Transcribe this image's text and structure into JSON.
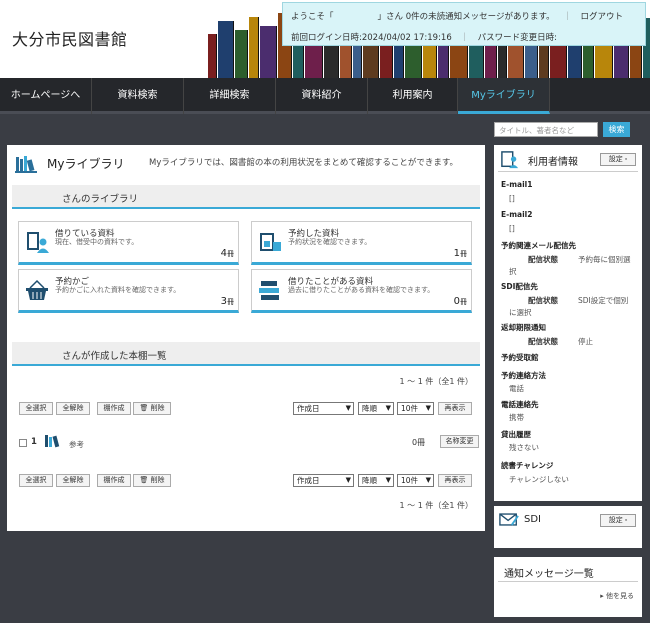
{
  "header": {
    "logo": "大分市民図書館",
    "welcome_prefix": "ようこそ「",
    "welcome_suffix": "」さん",
    "unread_notice": "0件の未読通知メッセージがあります。",
    "logout": "ログアウト",
    "last_login": "前回ログイン日時:2024/04/02 17:19:16",
    "password_changed": "パスワード変更日時:"
  },
  "nav": {
    "tabs": [
      "ホームページへ",
      "資料検索",
      "詳細検索",
      "資料紹介",
      "利用案内",
      "Myライブラリ"
    ],
    "active": 5
  },
  "search": {
    "placeholder": "タイトル、著者名など",
    "button": "検索"
  },
  "main": {
    "title": "Myライブラリ",
    "description": "Myライブラリでは、図書館の本の利用状況をまとめて確認することができます。",
    "library_heading": "さんのライブラリ",
    "cards": [
      {
        "title": "借りている資料",
        "desc": "現在、借受中の資料です。",
        "count": "4",
        "unit": "冊"
      },
      {
        "title": "予約した資料",
        "desc": "予約状況を確認できます。",
        "count": "1",
        "unit": "冊"
      },
      {
        "title": "予約かご",
        "desc": "予約かごに入れた資料を確認できます。",
        "count": "3",
        "unit": "冊"
      },
      {
        "title": "借りたことがある資料",
        "desc": "過去に借りたことがある資料を確認できます。",
        "count": "0",
        "unit": "冊"
      }
    ],
    "shelf_heading": "さんが作成した本棚一覧",
    "pager": "1 ～ 1 件（全1 件）",
    "toolbar": {
      "select_all": "全選択",
      "clear_all": "全解除",
      "create_shelf": "棚作成",
      "delete": "削除",
      "sort": "作成日",
      "order": "降順",
      "per_page": "10件",
      "redisplay": "再表示"
    },
    "shelf_row": {
      "index": "1",
      "name": "参考",
      "count": "0冊",
      "rename": "名称変更"
    }
  },
  "sidebar": {
    "user_info": {
      "title": "利用者情報",
      "settings": "設定",
      "email1_label": "E-mail1",
      "email1_value": "[]",
      "email2_label": "E-mail2",
      "email2_value": "[]",
      "reserve_mail_label": "予約関連メール配信先",
      "reserve_mail_status": "配信状態",
      "reserve_mail_value_a": "予約毎に個別選",
      "reserve_mail_value_b": "択",
      "sdi_label": "SDI配信先",
      "sdi_status": "配信状態",
      "sdi_value_a": "SDI設定で個別",
      "sdi_value_b": "に選択",
      "return_label": "返却期限通知",
      "return_status": "配信状態",
      "return_value": "停止",
      "pickup_label": "予約受取館",
      "contact_label": "予約連絡方法",
      "contact_value": "電話",
      "phone_label": "電話連絡先",
      "phone_value": "携帯",
      "history_label": "貸出履歴",
      "history_value": "残さない",
      "challenge_label": "読書チャレンジ",
      "challenge_value": "チャレンジしない"
    },
    "sdi": {
      "title": "SDI",
      "settings": "設定"
    },
    "messages": {
      "title": "通知メッセージ一覧",
      "more": "他を見る"
    }
  }
}
